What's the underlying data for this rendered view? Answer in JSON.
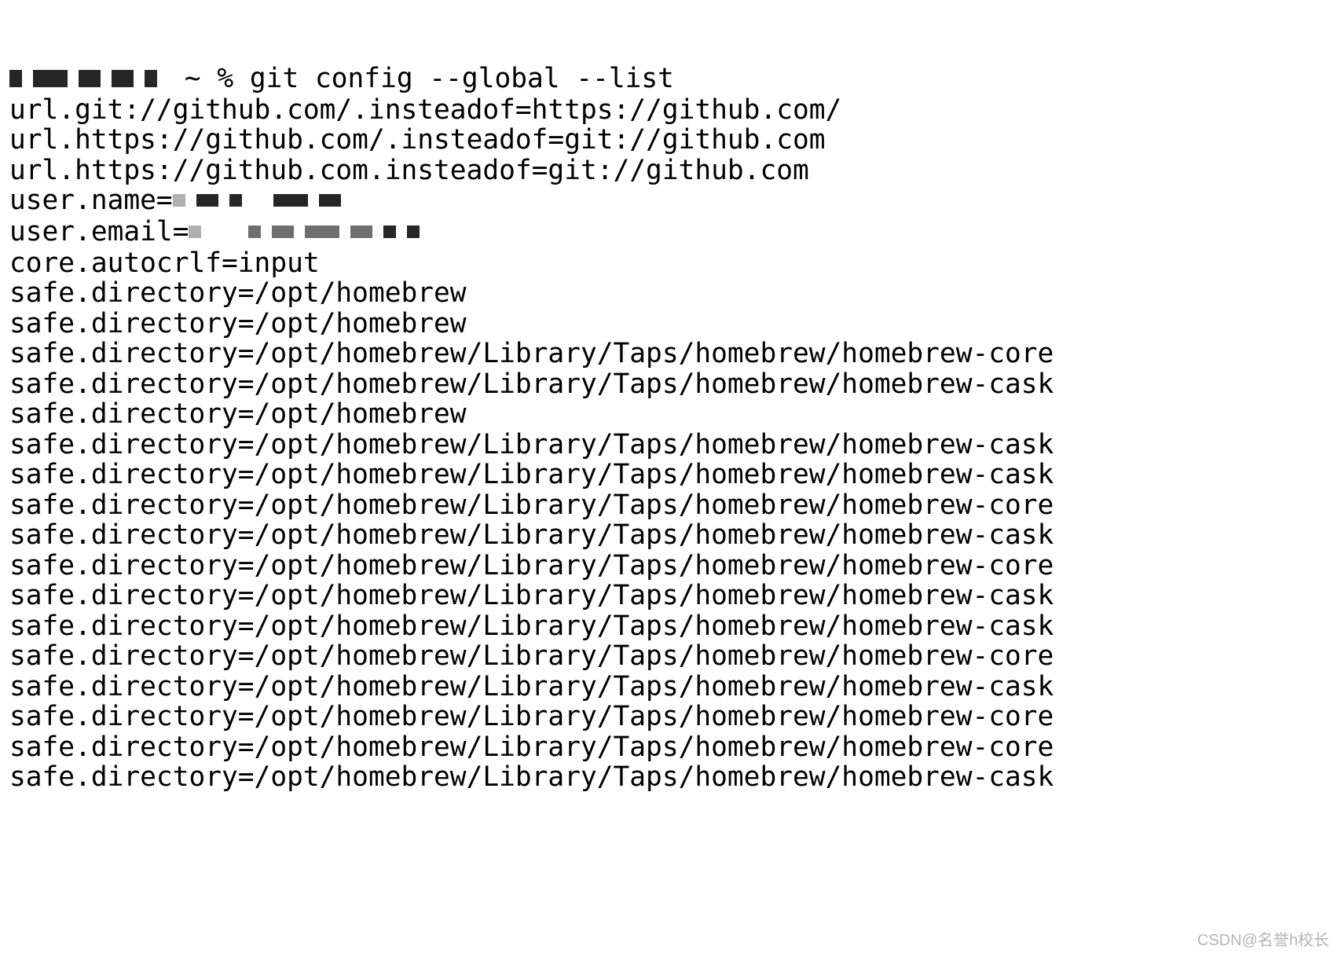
{
  "prompt": {
    "prefix_redacted": true,
    "dir_symbol": "~",
    "sep": "%",
    "command": "git config --global --list"
  },
  "output_lines": [
    "url.git://github.com/.insteadof=https://github.com/",
    "url.https://github.com/.insteadof=git://github.com",
    "url.https://github.com.insteadof=git://github.com",
    "__USER_NAME__",
    "__USER_EMAIL__",
    "core.autocrlf=input",
    "safe.directory=/opt/homebrew",
    "safe.directory=/opt/homebrew",
    "safe.directory=/opt/homebrew/Library/Taps/homebrew/homebrew-core",
    "safe.directory=/opt/homebrew/Library/Taps/homebrew/homebrew-cask",
    "safe.directory=/opt/homebrew",
    "safe.directory=/opt/homebrew/Library/Taps/homebrew/homebrew-cask",
    "safe.directory=/opt/homebrew/Library/Taps/homebrew/homebrew-cask",
    "safe.directory=/opt/homebrew/Library/Taps/homebrew/homebrew-core",
    "safe.directory=/opt/homebrew/Library/Taps/homebrew/homebrew-cask",
    "safe.directory=/opt/homebrew/Library/Taps/homebrew/homebrew-core",
    "safe.directory=/opt/homebrew/Library/Taps/homebrew/homebrew-cask",
    "safe.directory=/opt/homebrew/Library/Taps/homebrew/homebrew-cask",
    "safe.directory=/opt/homebrew/Library/Taps/homebrew/homebrew-core",
    "safe.directory=/opt/homebrew/Library/Taps/homebrew/homebrew-cask",
    "safe.directory=/opt/homebrew/Library/Taps/homebrew/homebrew-core",
    "safe.directory=/opt/homebrew/Library/Taps/homebrew/homebrew-core",
    "safe.directory=/opt/homebrew/Library/Taps/homebrew/homebrew-cask"
  ],
  "labels": {
    "user_name_key": "user.name=",
    "user_email_key": "user.email="
  },
  "watermark": "CSDN@名誉h校长"
}
